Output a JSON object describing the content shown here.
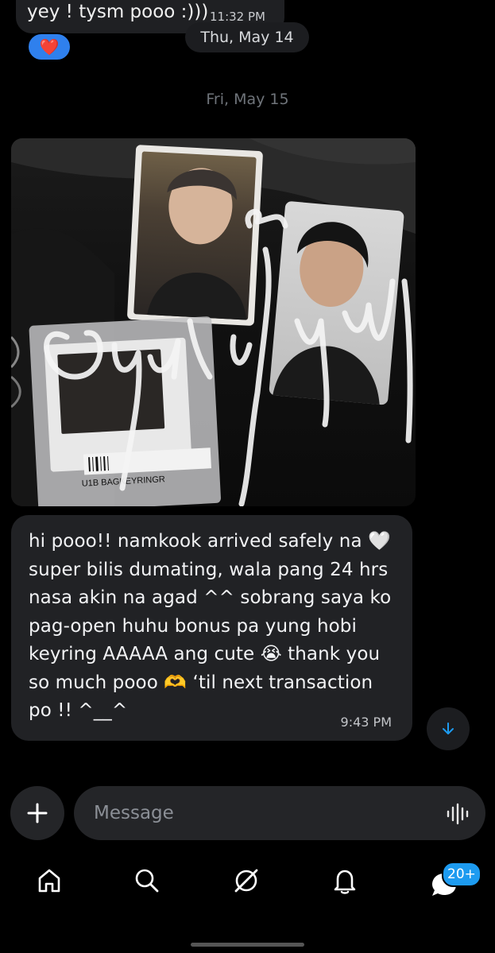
{
  "previous_message": {
    "text": "yey ! tysm pooo :)))",
    "time": "11:32 PM",
    "reaction": "❤️"
  },
  "date_pill": "Thu, May 14",
  "date_separator": "Fri, May 15",
  "attachment": {
    "type": "photo",
    "visible_text": "U1B  BAGKEYRINGR"
  },
  "message": {
    "text": "hi pooo!! namkook arrived safely na 🤍\nsuper bilis dumating, wala pang 24 hrs\nnasa akin na agad ^^ sobrang saya ko\npag-open huhu bonus pa yung hobi\nkeyring AAAAA ang cute 😭 thank you\nso much pooo 🫶 ‘til next transaction\npo !! ^__^",
    "time": "9:43 PM"
  },
  "composer": {
    "placeholder": "Message"
  },
  "nav": {
    "items": [
      "home-icon",
      "search-icon",
      "grok-icon",
      "notifications-icon",
      "messages-icon"
    ],
    "badge": "20+"
  },
  "colors": {
    "background": "#000000",
    "bubble": "#212225",
    "accent": "#1d9bf0",
    "reaction_bg": "#2f80ed"
  }
}
